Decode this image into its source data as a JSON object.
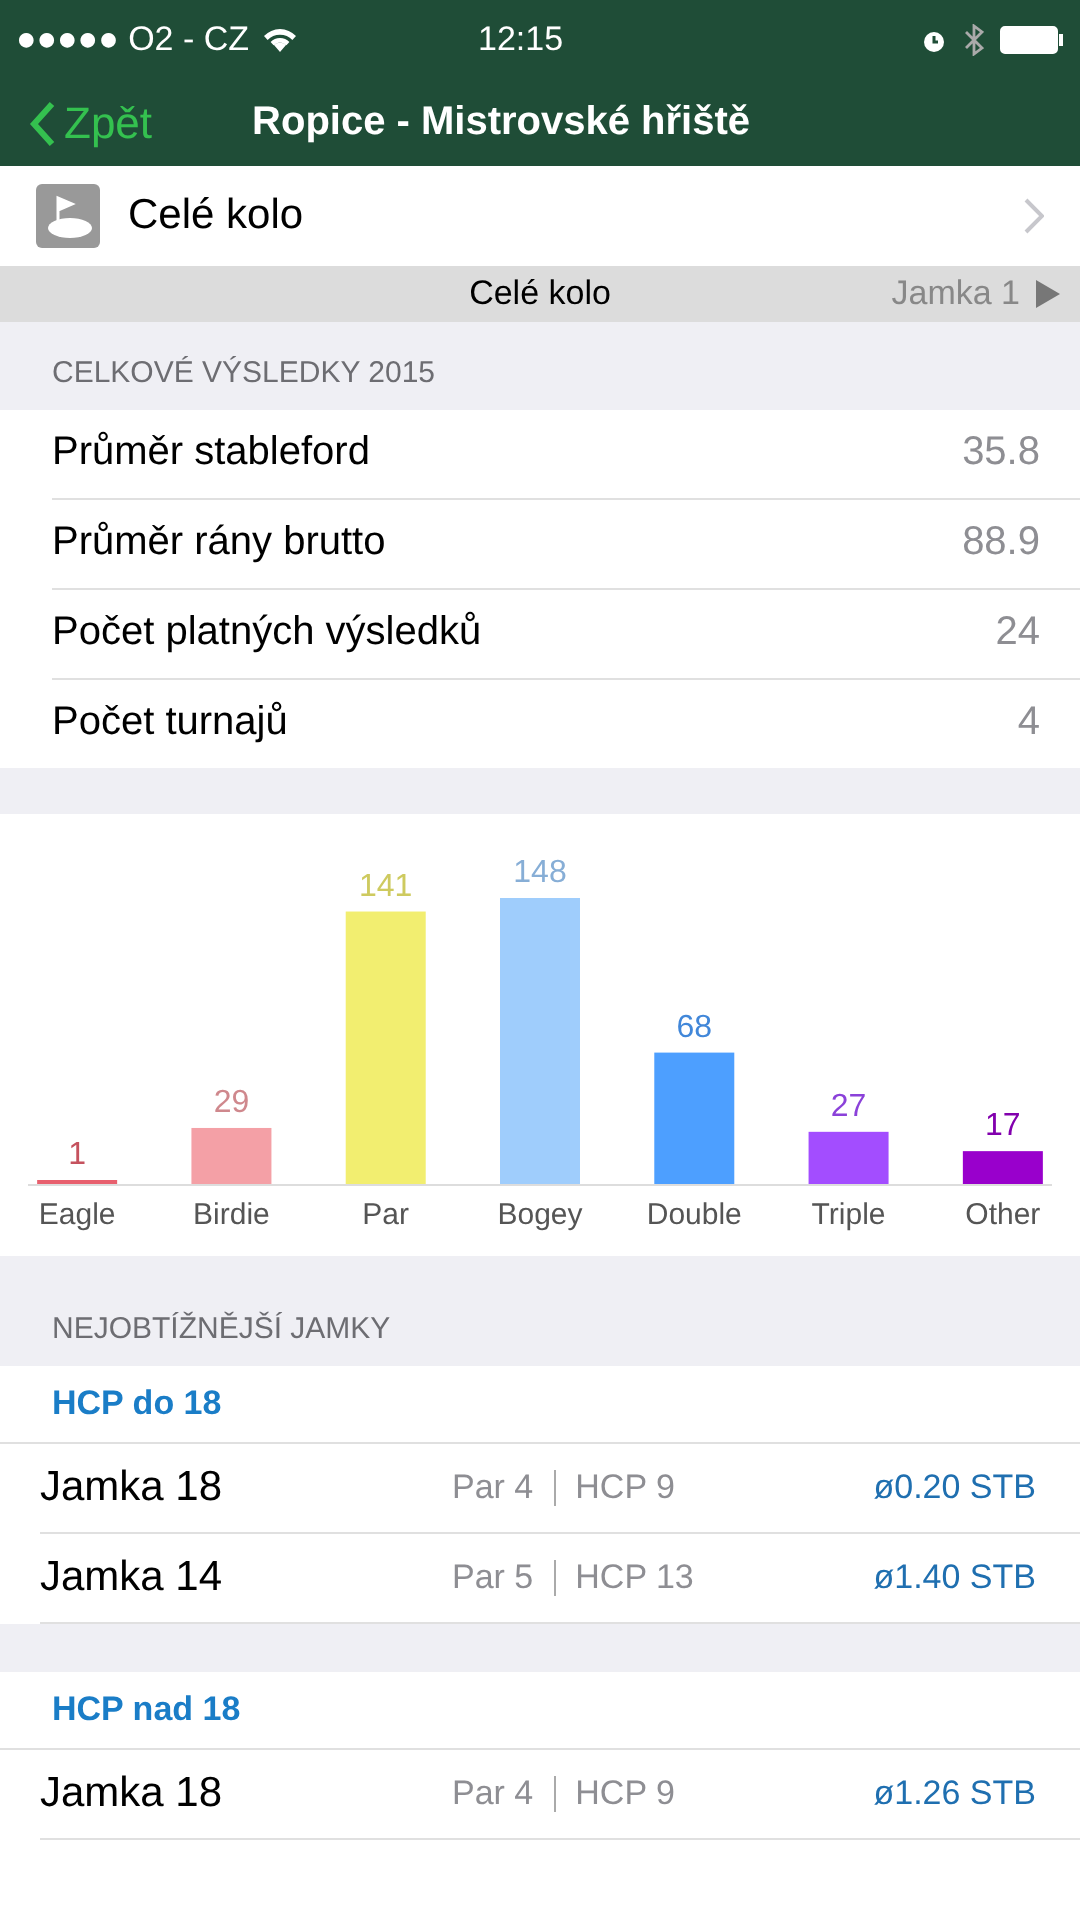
{
  "status_bar": {
    "carrier": "●●●●● O2 - CZ",
    "time": "12:15"
  },
  "nav": {
    "back": "Zpět",
    "title": "Ropice - Mistrovské hřiště"
  },
  "course_row": {
    "label": "Celé kolo"
  },
  "segment_bar": {
    "current": "Celé kolo",
    "next": "Jamka 1"
  },
  "results_section": {
    "header": "CELKOVÉ VÝSLEDKY 2015",
    "rows": [
      {
        "label": "Průměr stableford",
        "value": "35.8"
      },
      {
        "label": "Průměr rány brutto",
        "value": "88.9"
      },
      {
        "label": "Počet platných výsledků",
        "value": "24"
      },
      {
        "label": "Počet turnajů",
        "value": "4"
      }
    ]
  },
  "chart": {
    "chart_data": {
      "type": "bar",
      "categories": [
        "Eagle",
        "Birdie",
        "Par",
        "Bogey",
        "Double",
        "Triple",
        "Other"
      ],
      "value_labels": [
        "1",
        "29",
        "141",
        "148",
        "68",
        "27",
        "17"
      ],
      "values": [
        1,
        29,
        141,
        148,
        68,
        27,
        17
      ],
      "colors": [
        "#e8606e",
        "#f4a0a6",
        "#f2ee70",
        "#9fcdfc",
        "#4d9fff",
        "#a34dff",
        "#9900cc"
      ]
    }
  },
  "holes_section": {
    "header": "NEJOBTÍŽNĚJŠÍ JAMKY",
    "groups": [
      {
        "title": "HCP do 18",
        "rows": [
          {
            "hole": "Jamka 18",
            "par": "Par 4",
            "hcp": "HCP 9",
            "stb": "ø0.20 STB"
          },
          {
            "hole": "Jamka 14",
            "par": "Par 5",
            "hcp": "HCP 13",
            "stb": "ø1.40 STB"
          }
        ]
      },
      {
        "title": "HCP nad 18",
        "rows": [
          {
            "hole": "Jamka 18",
            "par": "Par 4",
            "hcp": "HCP 9",
            "stb": "ø1.26 STB"
          }
        ]
      }
    ]
  }
}
